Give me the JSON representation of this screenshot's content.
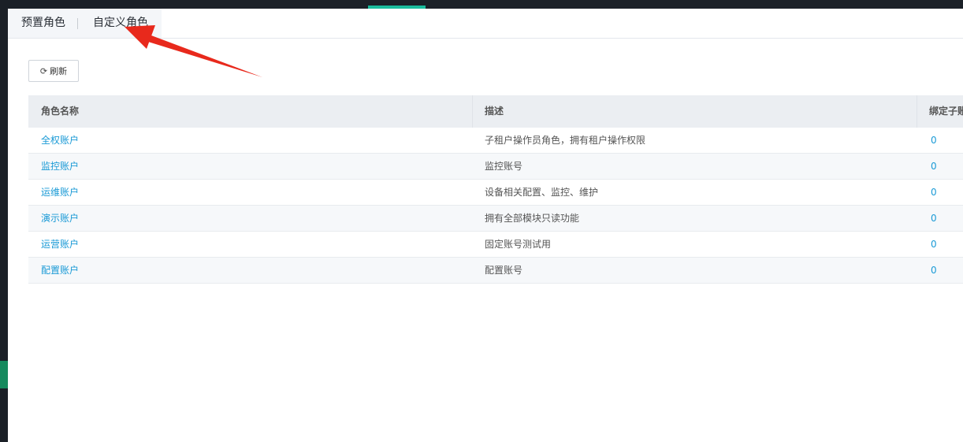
{
  "tabs": [
    {
      "label": "预置角色"
    },
    {
      "label": "自定义角色"
    }
  ],
  "toolbar": {
    "refresh_icon": "refresh-icon",
    "refresh_label": "刷新"
  },
  "table": {
    "columns": [
      "角色名称",
      "描述",
      "绑定子账"
    ],
    "rows": [
      {
        "name": "全权账户",
        "desc": "子租户操作员角色，拥有租户操作权限",
        "bound": "0"
      },
      {
        "name": "监控账户",
        "desc": "监控账号",
        "bound": "0"
      },
      {
        "name": "运维账户",
        "desc": "设备相关配置、监控、维护",
        "bound": "0"
      },
      {
        "name": "演示账户",
        "desc": "拥有全部模块只读功能",
        "bound": "0"
      },
      {
        "name": "运营账户",
        "desc": "固定账号测试用",
        "bound": "0"
      },
      {
        "name": "配置账户",
        "desc": "配置账号",
        "bound": "0"
      }
    ]
  },
  "colors": {
    "accent": "#1abc9c",
    "link": "#1a9ad6",
    "annotation_arrow": "#e8291c"
  }
}
